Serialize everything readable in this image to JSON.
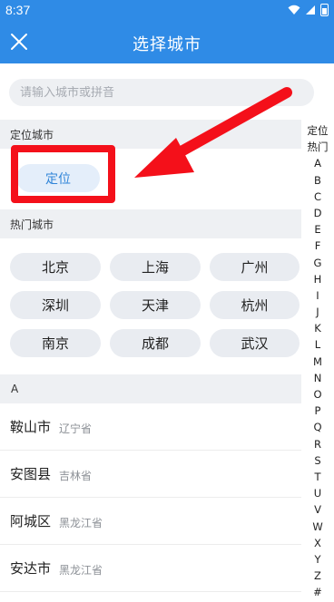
{
  "status": {
    "time": "8:37"
  },
  "header": {
    "title": "选择城市",
    "close": "close-icon"
  },
  "search": {
    "placeholder": "请输入城市或拼音"
  },
  "location_section": {
    "title": "定位城市",
    "button": "定位"
  },
  "hot_section": {
    "title": "热门城市",
    "cities": [
      "北京",
      "上海",
      "广州",
      "深圳",
      "天津",
      "杭州",
      "南京",
      "成都",
      "武汉"
    ]
  },
  "letter_group": "A",
  "city_list": [
    {
      "name": "鞍山市",
      "province": "辽宁省"
    },
    {
      "name": "安图县",
      "province": "吉林省"
    },
    {
      "name": "阿城区",
      "province": "黑龙江省"
    },
    {
      "name": "安达市",
      "province": "黑龙江省"
    }
  ],
  "index_bar": [
    "定位",
    "热门",
    "A",
    "B",
    "C",
    "D",
    "E",
    "F",
    "G",
    "H",
    "I",
    "J",
    "K",
    "L",
    "M",
    "N",
    "O",
    "P",
    "Q",
    "R",
    "S",
    "T",
    "U",
    "V",
    "W",
    "X",
    "Y",
    "Z",
    "#"
  ],
  "colors": {
    "header": "#2f8be6",
    "annotation": "#f4101a",
    "locate_text": "#2f84d8"
  }
}
